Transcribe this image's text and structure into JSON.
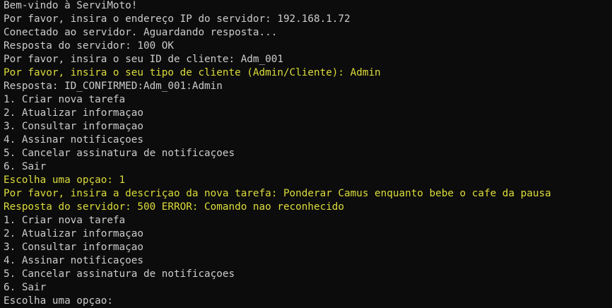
{
  "colors": {
    "background": "#0c0c0c",
    "default_text": "#cccccc",
    "highlight_text": "#dcdc3c"
  },
  "lines": [
    {
      "text": "Bem-vindo à ServiMoto!",
      "color": "default"
    },
    {
      "text": "Por favor, insira o endereço IP do servidor: 192.168.1.72",
      "color": "default"
    },
    {
      "text": "Conectado ao servidor. Aguardando resposta...",
      "color": "default"
    },
    {
      "text": "Resposta do servidor: 100 OK",
      "color": "default"
    },
    {
      "text": "Por favor, insira o seu ID de cliente: Adm_001",
      "color": "default"
    },
    {
      "text": "Por favor, insira o seu tipo de cliente (Admin/Cliente): Admin",
      "color": "yellow"
    },
    {
      "text": "Resposta: ID_CONFIRMED:Adm_001:Admin",
      "color": "default"
    },
    {
      "text": "1. Criar nova tarefa",
      "color": "default"
    },
    {
      "text": "2. Atualizar informaçao",
      "color": "default"
    },
    {
      "text": "3. Consultar informaçao",
      "color": "default"
    },
    {
      "text": "4. Assinar notificaçoes",
      "color": "default"
    },
    {
      "text": "5. Cancelar assinatura de notificaçoes",
      "color": "default"
    },
    {
      "text": "6. Sair",
      "color": "default"
    },
    {
      "text": "Escolha uma opçao: 1",
      "color": "yellow"
    },
    {
      "text": "Por favor, insira a descriçao da nova tarefa: Ponderar Camus enquanto bebe o cafe da pausa",
      "color": "yellow"
    },
    {
      "text": "Resposta do servidor: 500 ERROR: Comando nao reconhecido",
      "color": "yellow"
    },
    {
      "text": "1. Criar nova tarefa",
      "color": "default"
    },
    {
      "text": "2. Atualizar informaçao",
      "color": "default"
    },
    {
      "text": "3. Consultar informaçao",
      "color": "default"
    },
    {
      "text": "4. Assinar notificaçoes",
      "color": "default"
    },
    {
      "text": "5. Cancelar assinatura de notificaçoes",
      "color": "default"
    },
    {
      "text": "6. Sair",
      "color": "default"
    },
    {
      "text": "Escolha uma opçao:",
      "color": "default"
    }
  ]
}
